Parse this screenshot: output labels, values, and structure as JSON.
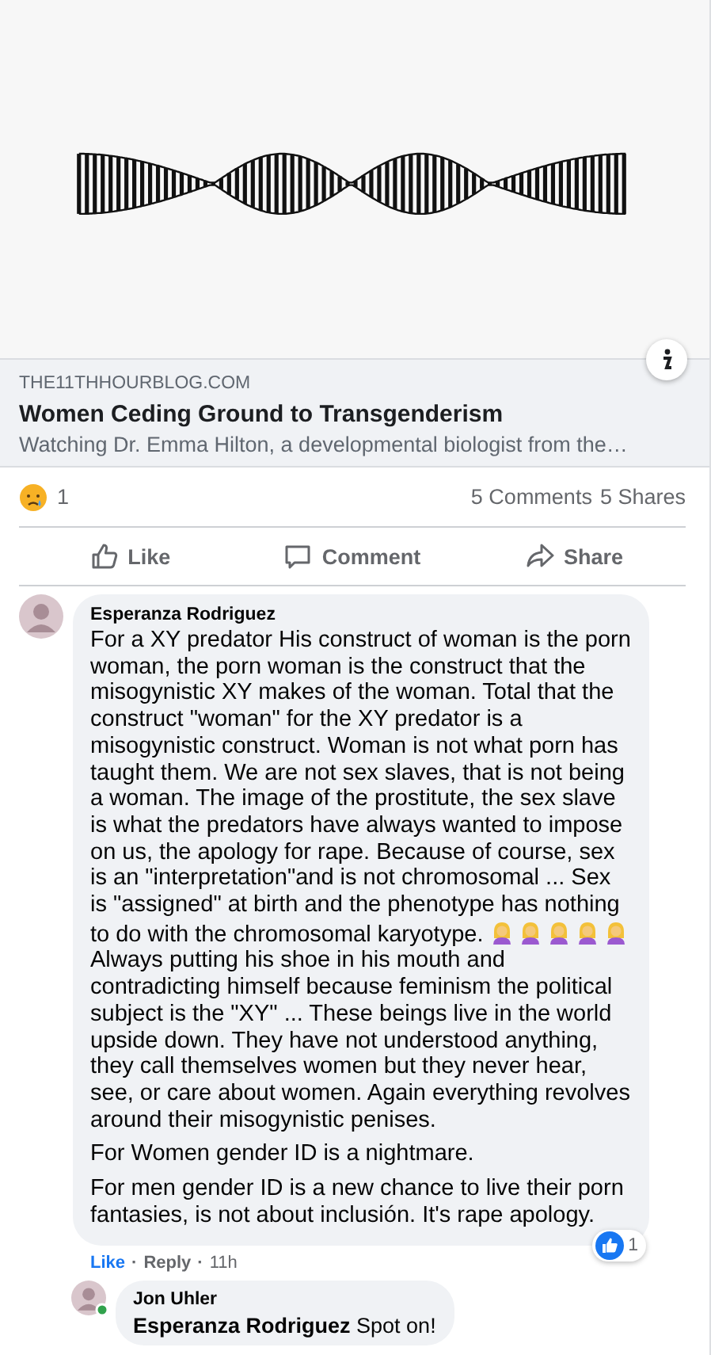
{
  "link_preview": {
    "domain": "THE11THHOURBLOG.COM",
    "title": "Women Ceding Ground to Transgenderism",
    "description": "Watching Dr. Emma Hilton, a developmental biologist from the…"
  },
  "reactions": {
    "count": "1"
  },
  "stats": [
    "5 Comments",
    "5 Shares"
  ],
  "actions": [
    {
      "kind": "like",
      "label": "Like"
    },
    {
      "kind": "comment",
      "label": "Comment"
    },
    {
      "kind": "share",
      "label": "Share"
    }
  ],
  "comments": [
    {
      "author": "Esperanza Rodriguez",
      "liked": true,
      "paragraphs": [
        [
          {
            "kind": "text",
            "text": "For a XY predator His construct of woman is the porn woman, the porn woman is the construct that the misogynistic XY makes of the woman. Total that the construct \"woman\" for the XY predator is a misogynistic construct. Woman is not what porn has taught them. We are not sex slaves, that is not being a woman. The image of the prostitute, the sex slave is what the predators have always wanted to impose on us, the apology for rape. Because of course, sex is an \"interpretation\"and is not chromosomal ... Sex is \"assigned\" at birth and the phenotype has nothing to do with the chromosomal karyotype. "
          },
          {
            "kind": "emoji"
          },
          {
            "kind": "emoji"
          },
          {
            "kind": "emoji"
          },
          {
            "kind": "emoji"
          },
          {
            "kind": "emoji"
          },
          {
            "kind": "text",
            "text": " Always putting his shoe in his mouth and contradicting himself because feminism the political subject is the \"XY\" ... These beings live in the world upside down. They have not understood anything, they call themselves women but they never hear, see, or care about women. Again everything revolves around their misogynistic penises."
          }
        ],
        [
          {
            "kind": "text",
            "text": "For Women gender ID is a nightmare."
          }
        ],
        [
          {
            "kind": "text",
            "text": "For men gender ID is a new chance to live their porn fantasies, is not about inclusión. It's rape apology."
          }
        ]
      ],
      "links": [
        "Like",
        "Reply"
      ],
      "separator": "·",
      "time": "11h",
      "like_count": "1",
      "replies": [
        {
          "author": "Jon Uhler",
          "online": true,
          "text": "**Esperanza Rodriguez** Spot on!"
        }
      ]
    }
  ]
}
